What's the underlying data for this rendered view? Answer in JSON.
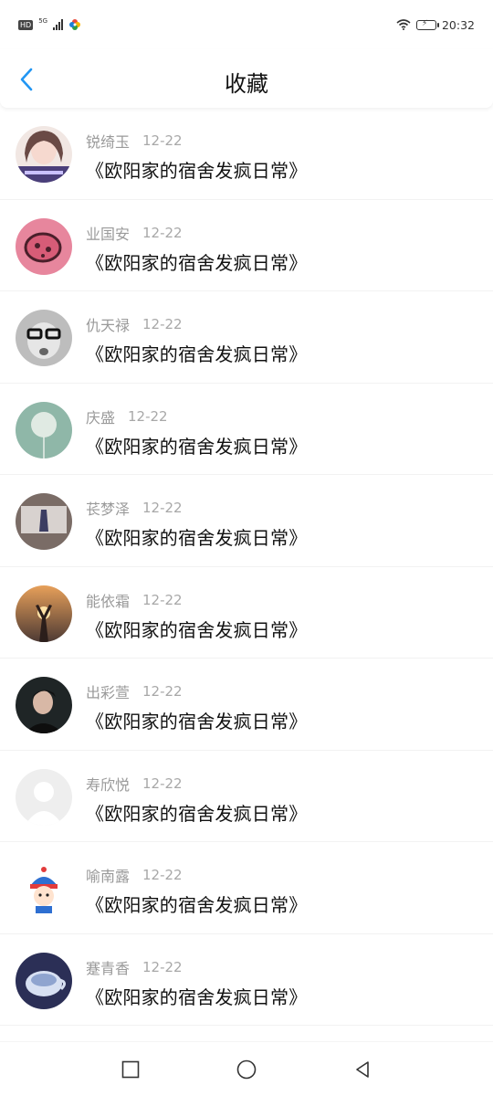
{
  "status_bar": {
    "badge": "HD",
    "network": "5G",
    "time": "20:32"
  },
  "header": {
    "title": "收藏"
  },
  "items": [
    {
      "name": "锐绮玉",
      "date": "12-22",
      "title": "《欧阳家的宿舍发疯日常》"
    },
    {
      "name": "业国安",
      "date": "12-22",
      "title": "《欧阳家的宿舍发疯日常》"
    },
    {
      "name": "仇天禄",
      "date": "12-22",
      "title": "《欧阳家的宿舍发疯日常》"
    },
    {
      "name": "庆盛",
      "date": "12-22",
      "title": "《欧阳家的宿舍发疯日常》"
    },
    {
      "name": "苌梦泽",
      "date": "12-22",
      "title": "《欧阳家的宿舍发疯日常》"
    },
    {
      "name": "能依霜",
      "date": "12-22",
      "title": "《欧阳家的宿舍发疯日常》"
    },
    {
      "name": "出彩萱",
      "date": "12-22",
      "title": "《欧阳家的宿舍发疯日常》"
    },
    {
      "name": "寿欣悦",
      "date": "12-22",
      "title": "《欧阳家的宿舍发疯日常》"
    },
    {
      "name": "喻南露",
      "date": "12-22",
      "title": "《欧阳家的宿舍发疯日常》"
    },
    {
      "name": "蹇青香",
      "date": "12-22",
      "title": "《欧阳家的宿舍发疯日常》"
    }
  ],
  "nav": {
    "icons": [
      "square-recents-icon",
      "circle-home-icon",
      "triangle-back-icon"
    ]
  },
  "colors": {
    "accent": "#2196f3",
    "muted_text": "#9a9a9a"
  }
}
